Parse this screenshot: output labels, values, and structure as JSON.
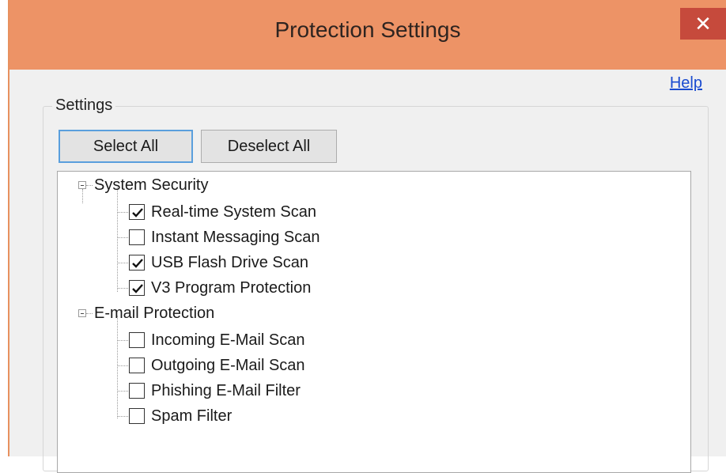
{
  "window": {
    "title": "Protection Settings",
    "close_glyph": "✕"
  },
  "help_link": "Help",
  "settings": {
    "group_label": "Settings",
    "select_all": "Select All",
    "deselect_all": "Deselect All"
  },
  "tree": {
    "expander_state": "expanded",
    "groups": [
      {
        "label": "System Security",
        "items": [
          {
            "label": "Real-time System Scan",
            "checked": true
          },
          {
            "label": "Instant Messaging Scan",
            "checked": false
          },
          {
            "label": "USB Flash Drive Scan",
            "checked": true
          },
          {
            "label": "V3 Program Protection",
            "checked": true
          }
        ]
      },
      {
        "label": "E-mail Protection",
        "items": [
          {
            "label": "Incoming E-Mail Scan",
            "checked": false
          },
          {
            "label": "Outgoing E-Mail Scan",
            "checked": false
          },
          {
            "label": "Phishing E-Mail Filter",
            "checked": false
          },
          {
            "label": "Spam Filter",
            "checked": false
          }
        ]
      }
    ]
  },
  "colors": {
    "titlebar": "#ed9366",
    "close_button": "#c64a3c",
    "link": "#1a4bd0",
    "focus_border": "#5a9fdd"
  }
}
